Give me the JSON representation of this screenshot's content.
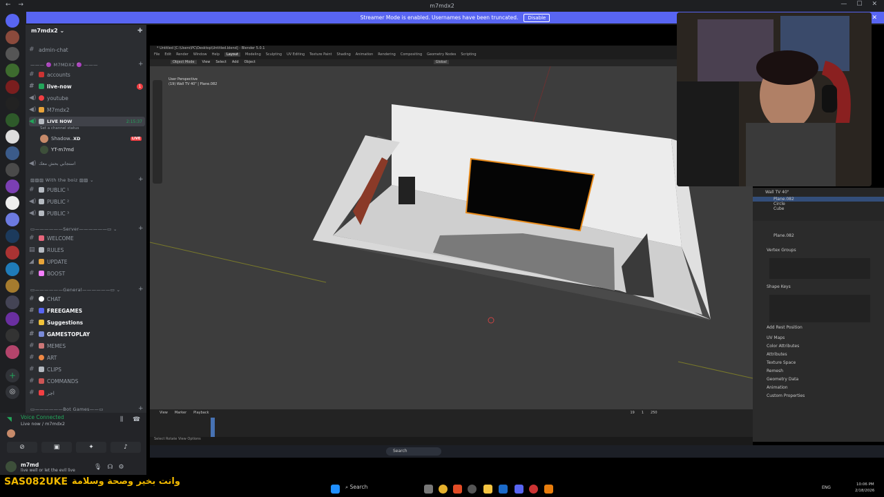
{
  "window": {
    "title": "m7mdx2"
  },
  "banner": {
    "text": "Streamer Mode is enabled. Usernames have been truncated.",
    "button": "Disable"
  },
  "server": {
    "name": "m7mdx2"
  },
  "channels": [
    {
      "label": "admin-chat"
    },
    {
      "label": "accounts"
    },
    {
      "label": "live-now"
    },
    {
      "label": "youtube"
    },
    {
      "label": "M7mdx2"
    },
    {
      "label": "LIVE NOW"
    },
    {
      "label": "Set a channel status"
    },
    {
      "label": "Shadow.."
    },
    {
      "label": "XD"
    },
    {
      "label": "YT-m7md"
    },
    {
      "label": "استجابي بحش معك"
    },
    {
      "label": "PUBLIC ¹"
    },
    {
      "label": "PUBLIC ²"
    },
    {
      "label": "PUBLIC ³"
    },
    {
      "label": "WELCOME"
    },
    {
      "label": "RULES"
    },
    {
      "label": "UPDATE"
    },
    {
      "label": "BOOST"
    },
    {
      "label": "CHAT"
    },
    {
      "label": "FREEGAMES"
    },
    {
      "label": "Suggestions"
    },
    {
      "label": "GAMESTOPLAY"
    },
    {
      "label": "MEMES"
    },
    {
      "label": "ART"
    },
    {
      "label": "CLIPS"
    },
    {
      "label": "COMMANDS"
    },
    {
      "label": "اجر"
    }
  ],
  "categories": {
    "c1": "M7MDX2",
    "c2": "With the boiz",
    "c3": "Server",
    "c4": "General",
    "c5": "Bot Games"
  },
  "live_badge": "LIVE",
  "live_time": "2:15:37",
  "badge_count": "1",
  "voice": {
    "status": "Voice Connected",
    "sub": "Live now / m7mdx2"
  },
  "user": {
    "name": "m7md",
    "status": "live well or let the evil live"
  },
  "overlay": {
    "name": "SAS082UKE",
    "arabic": "وانت بخير وصحة وسلامة"
  },
  "blender": {
    "title": "* Untitled [C:\\Users\\PC\\Desktop\\Untitled.blend] - Blender 5.0.1",
    "menus": [
      "File",
      "Edit",
      "Render",
      "Window",
      "Help"
    ],
    "workspaces": [
      "Layout",
      "Modeling",
      "Sculpting",
      "UV Editing",
      "Texture Paint",
      "Shading",
      "Animation",
      "Rendering",
      "Compositing",
      "Geometry Nodes",
      "Scripting"
    ],
    "viewport_label": "User Perspective",
    "viewport_sub": "(19) Wall TV 40\" | Plane.082",
    "mode": "Object Mode",
    "viewmenus": [
      "View",
      "Select",
      "Add",
      "Object"
    ],
    "transform": "Global",
    "outliner_items": [
      "Wall TV 40\"",
      "Plane.082",
      "Circle",
      "Cube"
    ],
    "props_path": "Plane.082",
    "props_sections": [
      "Vertex Groups",
      "Shape Keys",
      "Add Rest Position",
      "UV Maps",
      "Color Attributes",
      "Attributes",
      "Texture Space",
      "Remesh",
      "Geometry Data",
      "Animation",
      "Custom Properties"
    ],
    "timeline_menus": [
      "View",
      "Marker",
      "Playback"
    ],
    "frame": "19",
    "start": "1",
    "end": "250",
    "status_left": "Select   Rotate View   Options"
  },
  "taskbar": {
    "search": "Search",
    "lang": "ENG",
    "time": "10:06 PM",
    "date": "2/18/2026"
  },
  "colors": {
    "accent": "#5865f2",
    "green": "#23a55a",
    "red": "#f23f43",
    "overlay": "#f0b800"
  }
}
